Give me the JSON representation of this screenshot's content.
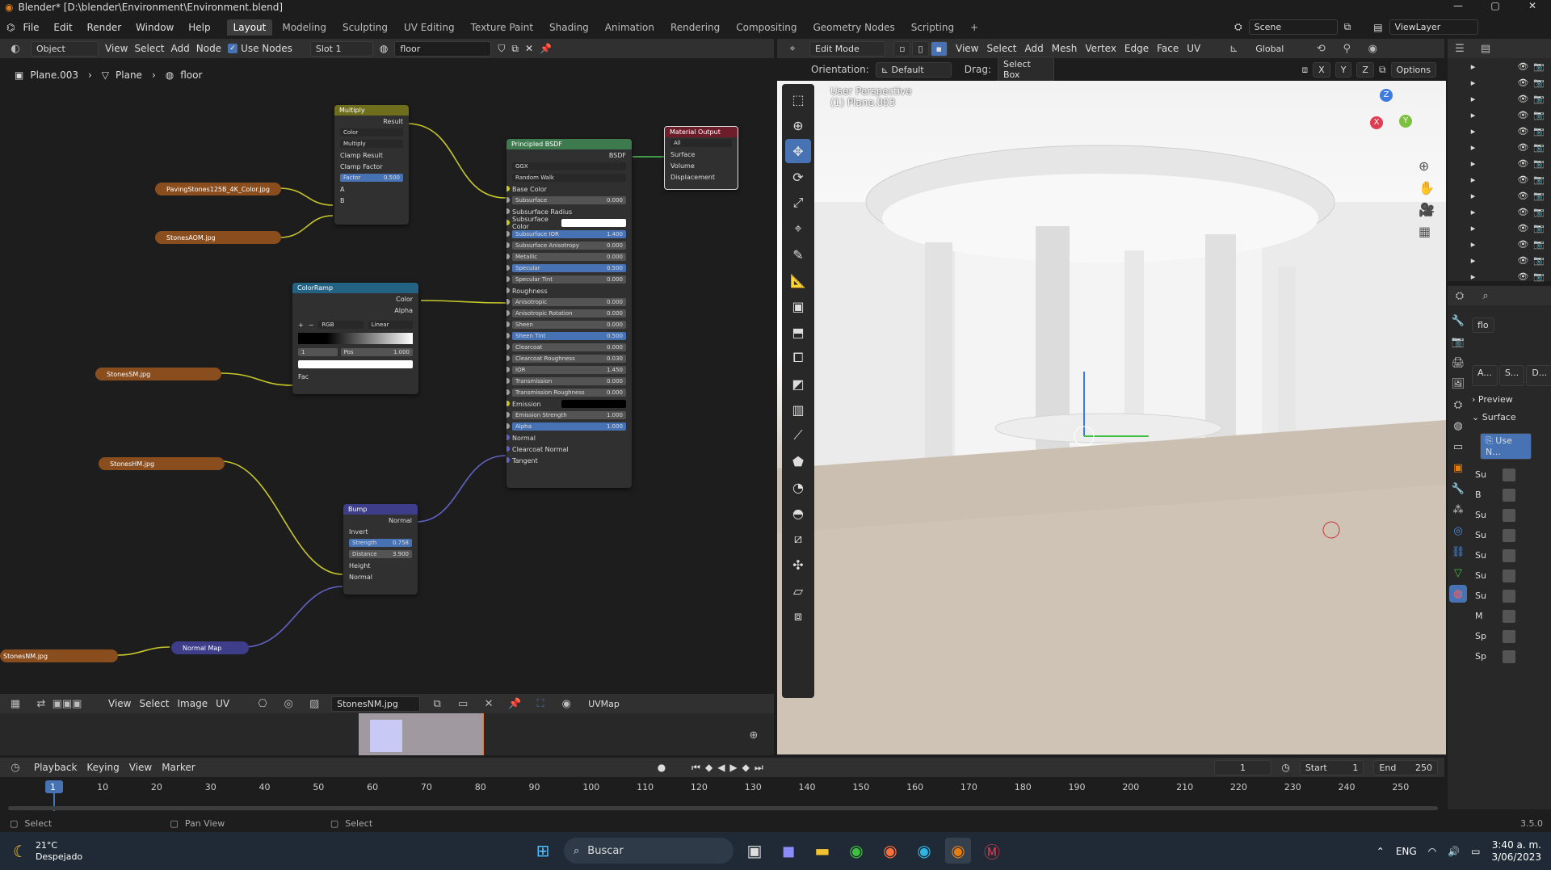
{
  "titlebar": {
    "title": "Blender* [D:\\blender\\Environment\\Environment.blend]"
  },
  "menu": [
    "File",
    "Edit",
    "Render",
    "Window",
    "Help"
  ],
  "workspaces": [
    "Layout",
    "Modeling",
    "Sculpting",
    "UV Editing",
    "Texture Paint",
    "Shading",
    "Animation",
    "Rendering",
    "Compositing",
    "Geometry Nodes",
    "Scripting"
  ],
  "scene": {
    "name": "Scene",
    "view_layer": "ViewLayer"
  },
  "node_editor": {
    "mode": "Object",
    "menus": [
      "View",
      "Select",
      "Add",
      "Node"
    ],
    "use_nodes_label": "Use Nodes",
    "slot": "Slot 1",
    "material": "floor",
    "breadcrumb": [
      "Plane.003",
      "Plane",
      "floor"
    ]
  },
  "nodes": {
    "multiply": {
      "title": "Multiply",
      "result": "Result",
      "type": "Color",
      "blend": "Multiply",
      "clamp_result": "Clamp Result",
      "clamp_factor": "Clamp Factor",
      "factor_label": "Factor",
      "factor": "0.500",
      "a": "A",
      "b": "B"
    },
    "principled": {
      "title": "Principled BSDF",
      "out": "BSDF",
      "distribution": "GGX",
      "subsurface_method": "Random Walk",
      "rows": [
        {
          "label": "Base Color",
          "value": "",
          "kind": "socket"
        },
        {
          "label": "Subsurface",
          "value": "0.000",
          "kind": "field"
        },
        {
          "label": "Subsurface Radius",
          "value": "",
          "kind": "dropdown"
        },
        {
          "label": "Subsurface Color",
          "value": "",
          "kind": "color"
        },
        {
          "label": "Subsurface IOR",
          "value": "1.400",
          "kind": "blue"
        },
        {
          "label": "Subsurface Anisotropy",
          "value": "0.000",
          "kind": "field"
        },
        {
          "label": "Metallic",
          "value": "0.000",
          "kind": "field"
        },
        {
          "label": "Specular",
          "value": "0.500",
          "kind": "blue"
        },
        {
          "label": "Specular Tint",
          "value": "0.000",
          "kind": "field"
        },
        {
          "label": "Roughness",
          "value": "",
          "kind": "socket"
        },
        {
          "label": "Anisotropic",
          "value": "0.000",
          "kind": "field"
        },
        {
          "label": "Anisotropic Rotation",
          "value": "0.000",
          "kind": "field"
        },
        {
          "label": "Sheen",
          "value": "0.000",
          "kind": "field"
        },
        {
          "label": "Sheen Tint",
          "value": "0.500",
          "kind": "blue"
        },
        {
          "label": "Clearcoat",
          "value": "0.000",
          "kind": "field"
        },
        {
          "label": "Clearcoat Roughness",
          "value": "0.030",
          "kind": "field"
        },
        {
          "label": "IOR",
          "value": "1.450",
          "kind": "field"
        },
        {
          "label": "Transmission",
          "value": "0.000",
          "kind": "field"
        },
        {
          "label": "Transmission Roughness",
          "value": "0.000",
          "kind": "field"
        },
        {
          "label": "Emission",
          "value": "",
          "kind": "black"
        },
        {
          "label": "Emission Strength",
          "value": "1.000",
          "kind": "field"
        },
        {
          "label": "Alpha",
          "value": "1.000",
          "kind": "blue"
        },
        {
          "label": "Normal",
          "value": "",
          "kind": "socket"
        },
        {
          "label": "Clearcoat Normal",
          "value": "",
          "kind": "socket"
        },
        {
          "label": "Tangent",
          "value": "",
          "kind": "socket"
        }
      ]
    },
    "output": {
      "title": "Material Output",
      "target": "All",
      "surface": "Surface",
      "volume": "Volume",
      "displacement": "Displacement"
    },
    "colorramp": {
      "title": "ColorRamp",
      "color": "Color",
      "alpha": "Alpha",
      "mode": "RGB",
      "interp": "Linear",
      "index": "1",
      "pos_label": "Pos",
      "pos": "1.000",
      "fac": "Fac"
    },
    "bump": {
      "title": "Bump",
      "normal_out": "Normal",
      "invert": "Invert",
      "strength_label": "Strength",
      "strength": "0.758",
      "distance_label": "Distance",
      "distance": "3.900",
      "height": "Height",
      "normal_in": "Normal"
    },
    "normalmap": {
      "title": "Normal Map"
    },
    "images": [
      "PavingStones125B_4K_Color.jpg",
      "StonesAOM.jpg",
      "StonesSM.jpg",
      "StonesHM.jpg",
      "StonesNM.jpg"
    ]
  },
  "image_editor": {
    "menus": [
      "View",
      "Select",
      "Image",
      "UV"
    ],
    "image": "StonesNM.jpg",
    "uvmap": "UVMap"
  },
  "viewport": {
    "mode": "Edit Mode",
    "menus": [
      "View",
      "Select",
      "Add",
      "Mesh",
      "Vertex",
      "Edge",
      "Face",
      "UV"
    ],
    "transform": "Global",
    "orientation_label": "Orientation:",
    "orientation": "Default",
    "drag_label": "Drag:",
    "drag": "Select Box",
    "axes": [
      "X",
      "Y",
      "Z"
    ],
    "options": "Options",
    "info_line1": "User Perspective",
    "info_line2": "(1) Plane.003",
    "gizmo": {
      "x": "X",
      "y": "Y",
      "z": "Z"
    }
  },
  "properties": {
    "material_short": "flo",
    "preview": "Preview",
    "surface": "Surface",
    "use_nodes": "Use N...",
    "short_labels": [
      "Su",
      "B",
      "Su",
      "Su",
      "Su",
      "Su",
      "Su",
      "M",
      "Sp",
      "Sp"
    ],
    "tabs": [
      "A...",
      "S...",
      "D..."
    ]
  },
  "timeline": {
    "menus": [
      "Playback",
      "Keying",
      "View",
      "Marker"
    ],
    "current": "1",
    "start_label": "Start",
    "start": "1",
    "end_label": "End",
    "end": "250",
    "ticks": [
      "1",
      "10",
      "20",
      "30",
      "40",
      "50",
      "60",
      "70",
      "80",
      "90",
      "100",
      "110",
      "120",
      "130",
      "140",
      "150",
      "160",
      "170",
      "180",
      "190",
      "200",
      "210",
      "220",
      "230",
      "240",
      "250"
    ]
  },
  "statusbar": {
    "left": "Select",
    "middle": "Pan View",
    "right": "Select",
    "version": "3.5.0"
  },
  "taskbar": {
    "temp": "21°C",
    "weather": "Despejado",
    "search": "Buscar",
    "lang": "ENG",
    "time": "3:40 a. m.",
    "date": "3/06/2023"
  }
}
